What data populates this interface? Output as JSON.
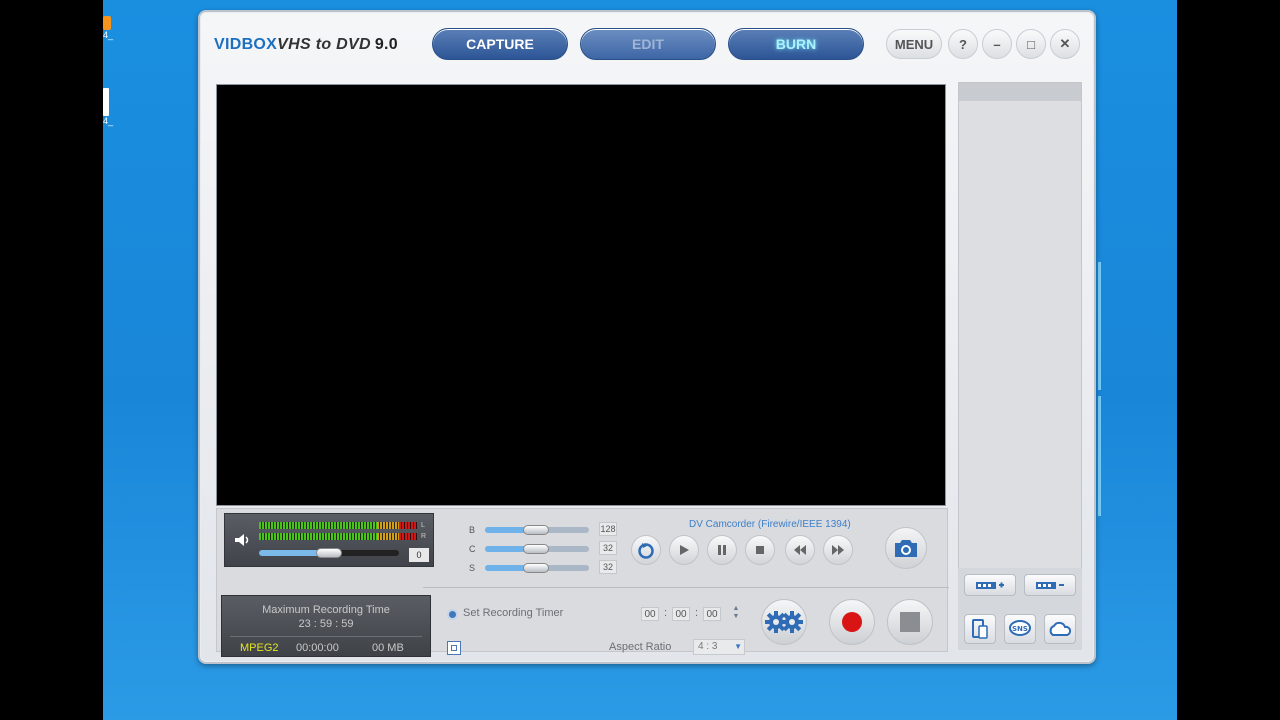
{
  "desktop": {
    "icon1_label": "4_",
    "icon2_label": "4_"
  },
  "app": {
    "logo_brand": "VIDBOX",
    "logo_product": "VHS to DVD",
    "logo_version": "9.0"
  },
  "tabs": [
    {
      "label": "CAPTURE"
    },
    {
      "label": "EDIT"
    },
    {
      "label": "BURN"
    }
  ],
  "titlebar": {
    "menu_label": "MENU",
    "help_label": "?",
    "minimize_label": "–",
    "maximize_label": "□",
    "close_label": "✕"
  },
  "audio": {
    "left_label": "L",
    "right_label": "R",
    "volume_value": "0",
    "volume_level": 0.5
  },
  "adjustments": [
    {
      "label": "B",
      "value": "128"
    },
    {
      "label": "C",
      "value": "32"
    },
    {
      "label": "S",
      "value": "32"
    }
  ],
  "device": {
    "name": "DV Camcorder (Firewire/IEEE 1394)"
  },
  "recording_info": {
    "title": "Maximum Recording Time",
    "max_time": "23 : 59 : 59",
    "format": "MPEG2",
    "elapsed": "00:00:00",
    "size": "00 MB"
  },
  "timer": {
    "label": "Set Recording Timer",
    "hours": "00",
    "minutes": "00",
    "seconds": "00"
  },
  "aspect_ratio": {
    "label": "Aspect Ratio",
    "value": "4 : 3"
  },
  "icons": {
    "speaker": "speaker-icon",
    "refresh": "refresh-icon",
    "play": "play-icon",
    "pause": "pause-icon",
    "stop": "stop-icon",
    "rewind": "rewind-icon",
    "fast_forward": "fast-forward-icon",
    "camera": "camera-icon",
    "settings": "gears-icon",
    "record": "record-icon"
  },
  "colors": {
    "tab_blue": "#2d5596",
    "accent_blue": "#3d7fc9",
    "record_red": "#d81414",
    "format_yellow": "#e4e422"
  }
}
